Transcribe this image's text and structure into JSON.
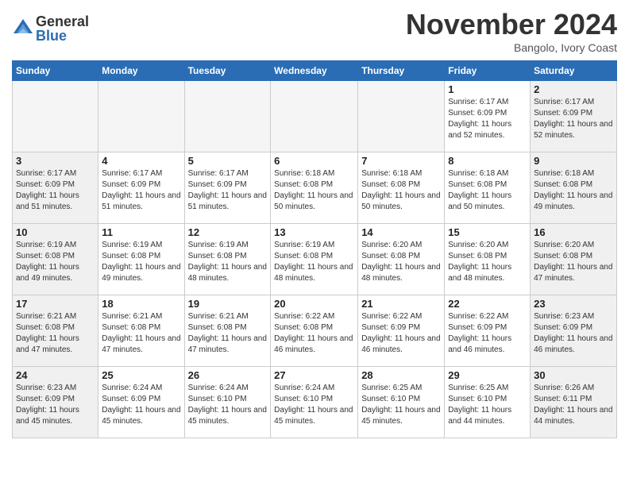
{
  "header": {
    "logo_general": "General",
    "logo_blue": "Blue",
    "month_title": "November 2024",
    "location": "Bangolo, Ivory Coast"
  },
  "weekdays": [
    "Sunday",
    "Monday",
    "Tuesday",
    "Wednesday",
    "Thursday",
    "Friday",
    "Saturday"
  ],
  "weeks": [
    [
      {
        "day": "",
        "info": ""
      },
      {
        "day": "",
        "info": ""
      },
      {
        "day": "",
        "info": ""
      },
      {
        "day": "",
        "info": ""
      },
      {
        "day": "",
        "info": ""
      },
      {
        "day": "1",
        "info": "Sunrise: 6:17 AM\nSunset: 6:09 PM\nDaylight: 11 hours and 52 minutes."
      },
      {
        "day": "2",
        "info": "Sunrise: 6:17 AM\nSunset: 6:09 PM\nDaylight: 11 hours and 52 minutes."
      }
    ],
    [
      {
        "day": "3",
        "info": "Sunrise: 6:17 AM\nSunset: 6:09 PM\nDaylight: 11 hours and 51 minutes."
      },
      {
        "day": "4",
        "info": "Sunrise: 6:17 AM\nSunset: 6:09 PM\nDaylight: 11 hours and 51 minutes."
      },
      {
        "day": "5",
        "info": "Sunrise: 6:17 AM\nSunset: 6:09 PM\nDaylight: 11 hours and 51 minutes."
      },
      {
        "day": "6",
        "info": "Sunrise: 6:18 AM\nSunset: 6:08 PM\nDaylight: 11 hours and 50 minutes."
      },
      {
        "day": "7",
        "info": "Sunrise: 6:18 AM\nSunset: 6:08 PM\nDaylight: 11 hours and 50 minutes."
      },
      {
        "day": "8",
        "info": "Sunrise: 6:18 AM\nSunset: 6:08 PM\nDaylight: 11 hours and 50 minutes."
      },
      {
        "day": "9",
        "info": "Sunrise: 6:18 AM\nSunset: 6:08 PM\nDaylight: 11 hours and 49 minutes."
      }
    ],
    [
      {
        "day": "10",
        "info": "Sunrise: 6:19 AM\nSunset: 6:08 PM\nDaylight: 11 hours and 49 minutes."
      },
      {
        "day": "11",
        "info": "Sunrise: 6:19 AM\nSunset: 6:08 PM\nDaylight: 11 hours and 49 minutes."
      },
      {
        "day": "12",
        "info": "Sunrise: 6:19 AM\nSunset: 6:08 PM\nDaylight: 11 hours and 48 minutes."
      },
      {
        "day": "13",
        "info": "Sunrise: 6:19 AM\nSunset: 6:08 PM\nDaylight: 11 hours and 48 minutes."
      },
      {
        "day": "14",
        "info": "Sunrise: 6:20 AM\nSunset: 6:08 PM\nDaylight: 11 hours and 48 minutes."
      },
      {
        "day": "15",
        "info": "Sunrise: 6:20 AM\nSunset: 6:08 PM\nDaylight: 11 hours and 48 minutes."
      },
      {
        "day": "16",
        "info": "Sunrise: 6:20 AM\nSunset: 6:08 PM\nDaylight: 11 hours and 47 minutes."
      }
    ],
    [
      {
        "day": "17",
        "info": "Sunrise: 6:21 AM\nSunset: 6:08 PM\nDaylight: 11 hours and 47 minutes."
      },
      {
        "day": "18",
        "info": "Sunrise: 6:21 AM\nSunset: 6:08 PM\nDaylight: 11 hours and 47 minutes."
      },
      {
        "day": "19",
        "info": "Sunrise: 6:21 AM\nSunset: 6:08 PM\nDaylight: 11 hours and 47 minutes."
      },
      {
        "day": "20",
        "info": "Sunrise: 6:22 AM\nSunset: 6:08 PM\nDaylight: 11 hours and 46 minutes."
      },
      {
        "day": "21",
        "info": "Sunrise: 6:22 AM\nSunset: 6:09 PM\nDaylight: 11 hours and 46 minutes."
      },
      {
        "day": "22",
        "info": "Sunrise: 6:22 AM\nSunset: 6:09 PM\nDaylight: 11 hours and 46 minutes."
      },
      {
        "day": "23",
        "info": "Sunrise: 6:23 AM\nSunset: 6:09 PM\nDaylight: 11 hours and 46 minutes."
      }
    ],
    [
      {
        "day": "24",
        "info": "Sunrise: 6:23 AM\nSunset: 6:09 PM\nDaylight: 11 hours and 45 minutes."
      },
      {
        "day": "25",
        "info": "Sunrise: 6:24 AM\nSunset: 6:09 PM\nDaylight: 11 hours and 45 minutes."
      },
      {
        "day": "26",
        "info": "Sunrise: 6:24 AM\nSunset: 6:10 PM\nDaylight: 11 hours and 45 minutes."
      },
      {
        "day": "27",
        "info": "Sunrise: 6:24 AM\nSunset: 6:10 PM\nDaylight: 11 hours and 45 minutes."
      },
      {
        "day": "28",
        "info": "Sunrise: 6:25 AM\nSunset: 6:10 PM\nDaylight: 11 hours and 45 minutes."
      },
      {
        "day": "29",
        "info": "Sunrise: 6:25 AM\nSunset: 6:10 PM\nDaylight: 11 hours and 44 minutes."
      },
      {
        "day": "30",
        "info": "Sunrise: 6:26 AM\nSunset: 6:11 PM\nDaylight: 11 hours and 44 minutes."
      }
    ]
  ]
}
